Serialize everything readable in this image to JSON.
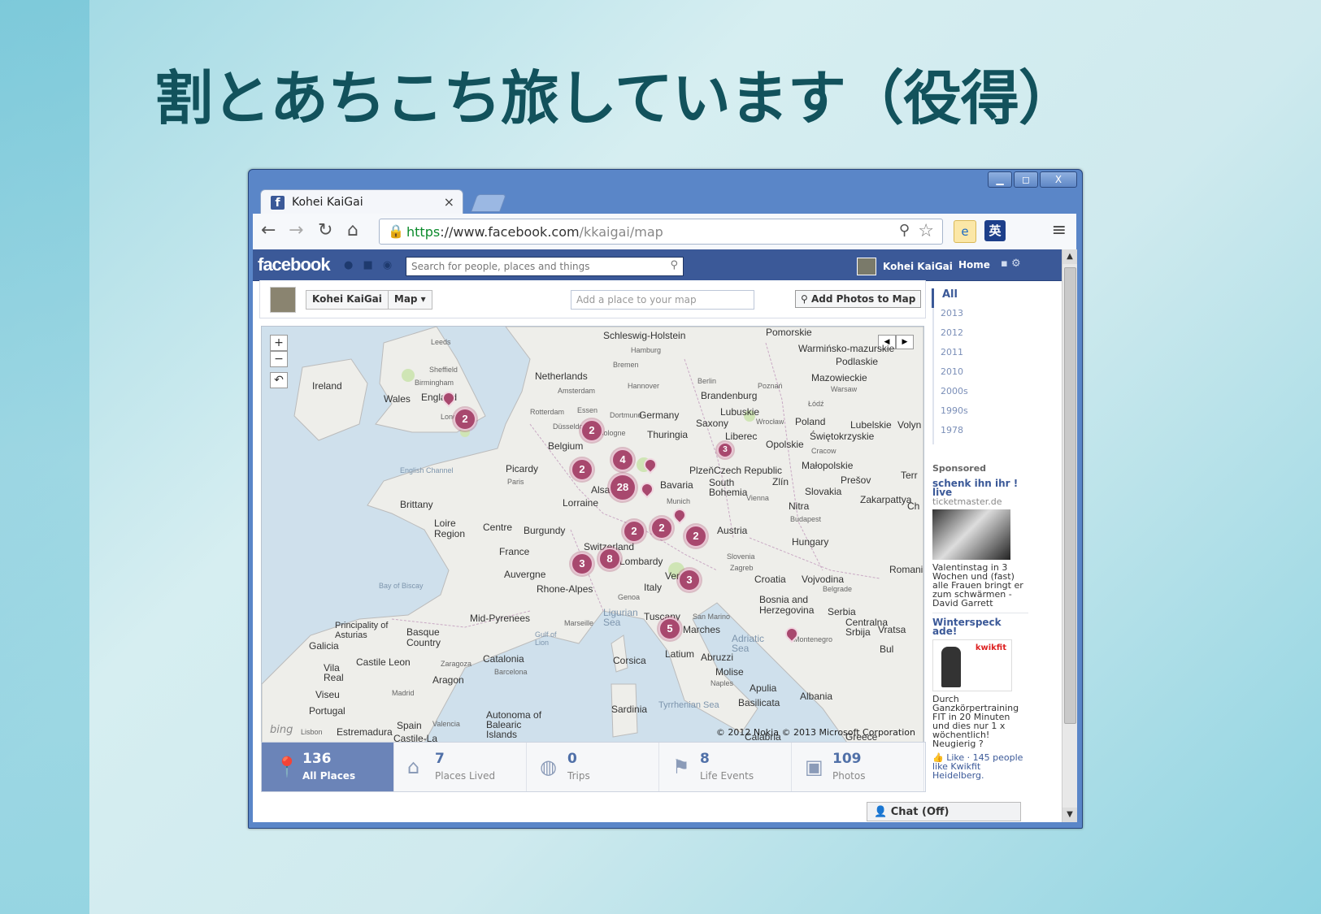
{
  "slide": {
    "title": "割とあちこち旅しています（役得）"
  },
  "window": {
    "minimize": "▁",
    "maximize": "◻",
    "close": "X"
  },
  "tab": {
    "favicon": "f",
    "title": "Kohei KaiGai",
    "close": "×"
  },
  "toolbar": {
    "back_icon": "arrow-left-icon",
    "forward_icon": "arrow-right-icon",
    "reload_icon": "reload-icon",
    "home_icon": "home-icon",
    "url_https": "https",
    "url_sep": "://",
    "url_host": "www.facebook.com",
    "url_path": "/kkaigai/map",
    "ext_ie": "e",
    "ext_eng": "英"
  },
  "facebook": {
    "logo": "facebook",
    "search_placeholder": "Search for people, places and things",
    "user_name": "Kohei KaiGai",
    "home": "Home",
    "crumb_name": "Kohei KaiGai",
    "crumb_map": "Map ▾",
    "add_place_placeholder": "Add a place to your map",
    "add_photos": "Add Photos to Map",
    "years": [
      "All",
      "2013",
      "2012",
      "2011",
      "2010",
      "2000s",
      "1990s",
      "1978"
    ],
    "sponsored": {
      "label": "Sponsored",
      "ad1_title": "schenk ihn ihr ! live",
      "ad1_url": "ticketmaster.de",
      "ad1_text": "Valentinstag in 3 Wochen und (fast) alle Frauen bringt er zum schwärmen - David Garrett",
      "ad2_title": "Winterspeck ade!",
      "ad2_brand": "kwikfit",
      "ad2_text": "Durch Ganzkörpertraining FIT in 20 Minuten und dies nur 1 x wöchentlich! Neugierig ?",
      "ad2_like": "Like · 145 people like Kwikfit Heidelberg."
    },
    "stats": [
      {
        "num": "136",
        "label": "All Places"
      },
      {
        "num": "7",
        "label": "Places Lived"
      },
      {
        "num": "0",
        "label": "Trips"
      },
      {
        "num": "8",
        "label": "Life Events"
      },
      {
        "num": "109",
        "label": "Photos"
      }
    ],
    "chat": "Chat (Off)"
  },
  "map": {
    "zoom_in": "+",
    "zoom_out": "−",
    "reset": "↶",
    "copyright": "© 2012 Nokia  © 2013 Microsoft Corporation",
    "bing": "bing",
    "clusters": [
      "2",
      "2",
      "4",
      "2",
      "28",
      "2",
      "2",
      "2",
      "3",
      "8",
      "3",
      "5",
      "3"
    ],
    "labels": {
      "schleswig": "Schleswig-Holstein",
      "pomorskie": "Pomorskie",
      "warminsko": "Warmińsko-mazurskie",
      "podlaskie": "Podlaskie",
      "mazowieckie": "Mazowieckie",
      "ireland": "Ireland",
      "wales": "Wales",
      "england": "England",
      "netherlands": "Netherlands",
      "brandenburg": "Brandenburg",
      "lubuskie": "Lubuskie",
      "germany": "Germany",
      "saxony": "Saxony",
      "poland": "Poland",
      "lubelskie": "Lubelskie",
      "volyn": "Volyn",
      "thuringia": "Thuringia",
      "belgium": "Belgium",
      "liberec": "Liberec",
      "opolskie": "Opolskie",
      "swietokrzyskie": "Świętokrzyskie",
      "picardy": "Picardy",
      "malopolskie": "Małopolskie",
      "plzen": "Plzeň",
      "czech": "Czech Republic",
      "zlin": "Zlín",
      "presov": "Prešov",
      "bavaria": "Bavaria",
      "southbohemia": "South\nBohemia",
      "slovakia": "Slovakia",
      "brittany": "Brittany",
      "lorraine": "Lorraine",
      "zakarpattya": "Zakarpattya",
      "nitra": "Nitra",
      "alsace": "Alsace",
      "loire": "Loire\nRegion",
      "centre": "Centre",
      "burgundy": "Burgundy",
      "austria": "Austria",
      "france": "France",
      "hungary": "Hungary",
      "switzerland": "Switzerland",
      "lombardy": "Lombardy",
      "auvergne": "Auvergne",
      "rhone": "Rhone-Alpes",
      "italy": "Italy",
      "veneto": "Veneto",
      "croatia": "Croatia",
      "vojvodina": "Vojvodina",
      "romania": "Romania",
      "bosnia": "Bosnia and\nHerzegovina",
      "serbia": "Serbia",
      "midpyrenees": "Mid-Pyrenees",
      "principality": "Principality of\nAsturias",
      "basque": "Basque\nCountry",
      "galicia": "Galicia",
      "castileleon": "Castile Leon",
      "catalonia": "Catalonia",
      "aragon": "Aragon",
      "vila": "Vila\nReal",
      "viseu": "Viseu",
      "portugal": "Portugal",
      "ligurian": "Ligurian\nSea",
      "tuscany": "Tuscany",
      "marches": "Marches",
      "centralna": "Centralna\nSrbija",
      "vratsa": "Vratsa",
      "latium": "Latium",
      "abruzzi": "Abruzzi",
      "corsica": "Corsica",
      "molise": "Molise",
      "apulia": "Apulia",
      "albania": "Albania",
      "sardinia": "Sardinia",
      "tyrrhenian": "Tyrrhenian Sea",
      "basilicata": "Basilicata",
      "estremadura": "Estremadura",
      "spain": "Spain",
      "castilelamancha": "Castile-La",
      "autonomous": "Autonoma of\nBalearic\nIslands",
      "calabria": "Calabria",
      "greece": "Greece",
      "adriatic": "Adriatic\nSea",
      "english_channel": "English Channel",
      "bay_biscay": "Bay of Biscay",
      "leeds": "Leeds",
      "sheffield": "Sheffield",
      "birmingham": "Birmingham",
      "london": "London",
      "rotterdam": "Rotterdam",
      "amsterdam": "Amsterdam",
      "hamburg": "Hamburg",
      "bremen": "Bremen",
      "hannover": "Hannover",
      "berlin": "Berlin",
      "poznan": "Poznań",
      "warsaw": "Warsaw",
      "lodz": "Łódź",
      "wroclaw": "Wrocław",
      "krakow": "Cracow",
      "dusseldorf": "Düsseldorf",
      "dortmund": "Dortmund",
      "essen": "Essen",
      "cologne": "Cologne",
      "paris": "Paris",
      "munich": "Munich",
      "vienna": "Vienna",
      "budapest": "Budapest",
      "marseille": "Marseille",
      "genoa": "Genoa",
      "zagreb": "Zagreb",
      "belgrade": "Belgrade",
      "naples": "Naples",
      "madrid": "Madrid",
      "zaragoza": "Zaragoza",
      "barcelona": "Barcelona",
      "valencia": "Valencia",
      "lisbon": "Lisbon",
      "sanmarino": "San Marino",
      "gulfoflion": "Gulf of\nLion",
      "slovenia": "Slovenia",
      "montenegro": "Montenegro",
      "bulgaria": "Bul",
      "terr": "Terr",
      "ch": "Ch"
    }
  }
}
